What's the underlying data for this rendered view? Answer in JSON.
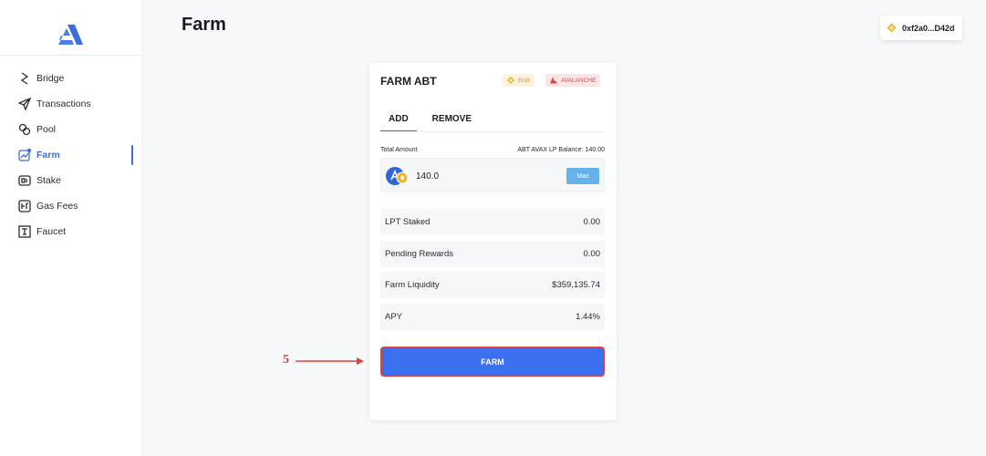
{
  "app": {
    "page_title": "Farm",
    "accent_color": "#3b6fe0",
    "wallet": {
      "address": "0xf2a0...D42d",
      "icon": "bnb-coin-icon"
    }
  },
  "sidebar": {
    "logo_icon": "app-logo-icon",
    "items": [
      {
        "label": "Bridge",
        "icon": "bridge-icon"
      },
      {
        "label": "Transactions",
        "icon": "send-icon"
      },
      {
        "label": "Pool",
        "icon": "pool-icon"
      },
      {
        "label": "Farm",
        "icon": "farm-chart-icon",
        "active": true
      },
      {
        "label": "Stake",
        "icon": "stake-icon"
      },
      {
        "label": "Gas Fees",
        "icon": "gas-fees-icon"
      },
      {
        "label": "Faucet",
        "icon": "faucet-icon"
      }
    ]
  },
  "card": {
    "title": "FARM ABT",
    "chips": [
      {
        "label": "BNB",
        "color": "#e0a23a"
      },
      {
        "label": "AVALANCHE",
        "color": "#d64646"
      }
    ],
    "tabs": [
      {
        "label": "ADD",
        "active": true
      },
      {
        "label": "REMOVE",
        "active": false
      }
    ],
    "amount": {
      "label": "Total Amount",
      "balance": "ABT AVAX LP Balance: 140.00",
      "value": "140.0",
      "max_label": "Max"
    },
    "stats": [
      {
        "label": "LPT Staked",
        "value": "0.00"
      },
      {
        "label": "Pending Rewards",
        "value": "0.00"
      },
      {
        "label": "Farm Liquidity",
        "value": "$359,135.74"
      },
      {
        "label": "APY",
        "value": "1.44%"
      }
    ],
    "farm_button": "FARM"
  },
  "annotation": {
    "step": "5",
    "color": "#e0403a"
  }
}
